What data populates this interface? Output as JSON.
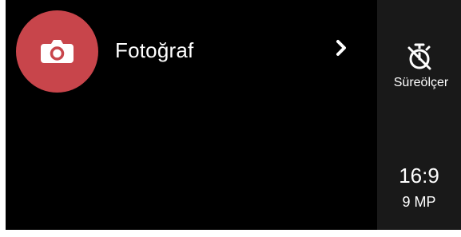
{
  "mode": {
    "label": "Fotoğraf",
    "icon": "camera-icon",
    "accent_color": "#c8454b"
  },
  "side_panel": {
    "timer": {
      "label": "Süreölçer",
      "icon": "timer-off-icon"
    },
    "aspect_ratio": {
      "value": "16:9",
      "resolution": "9 MP"
    }
  }
}
